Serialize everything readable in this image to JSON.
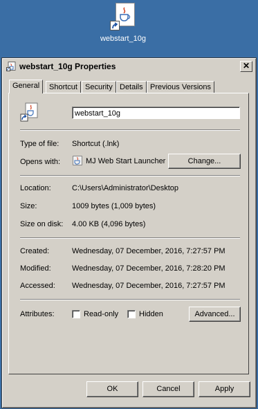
{
  "desktop": {
    "icon_label": "webstart_10g"
  },
  "window": {
    "title": "webstart_10g Properties",
    "close_glyph": "✕"
  },
  "tabs": [
    {
      "label": "General"
    },
    {
      "label": "Shortcut"
    },
    {
      "label": "Security"
    },
    {
      "label": "Details"
    },
    {
      "label": "Previous Versions"
    }
  ],
  "general": {
    "name_value": "webstart_10g",
    "type_label": "Type of file:",
    "type_value": "Shortcut (.lnk)",
    "opens_label": "Opens with:",
    "opens_value": "MJ Web Start Launcher",
    "change_button": "Change...",
    "location_label": "Location:",
    "location_value": "C:\\Users\\Administrator\\Desktop",
    "size_label": "Size:",
    "size_value": "1009 bytes (1,009 bytes)",
    "size_disk_label": "Size on disk:",
    "size_disk_value": "4.00 KB (4,096 bytes)",
    "created_label": "Created:",
    "created_value": "Wednesday, 07 December, 2016, 7:27:57 PM",
    "modified_label": "Modified:",
    "modified_value": "Wednesday, 07 December, 2016, 7:28:20 PM",
    "accessed_label": "Accessed:",
    "accessed_value": "Wednesday, 07 December, 2016, 7:27:57 PM",
    "attributes_label": "Attributes:",
    "readonly_label": "Read-only",
    "hidden_label": "Hidden",
    "advanced_button": "Advanced..."
  },
  "footer": {
    "ok": "OK",
    "cancel": "Cancel",
    "apply": "Apply"
  },
  "colors": {
    "desktop": "#3a6ea5",
    "face": "#d4d0c8",
    "java_red": "#d44a2a",
    "java_blue": "#3b6fb6"
  }
}
